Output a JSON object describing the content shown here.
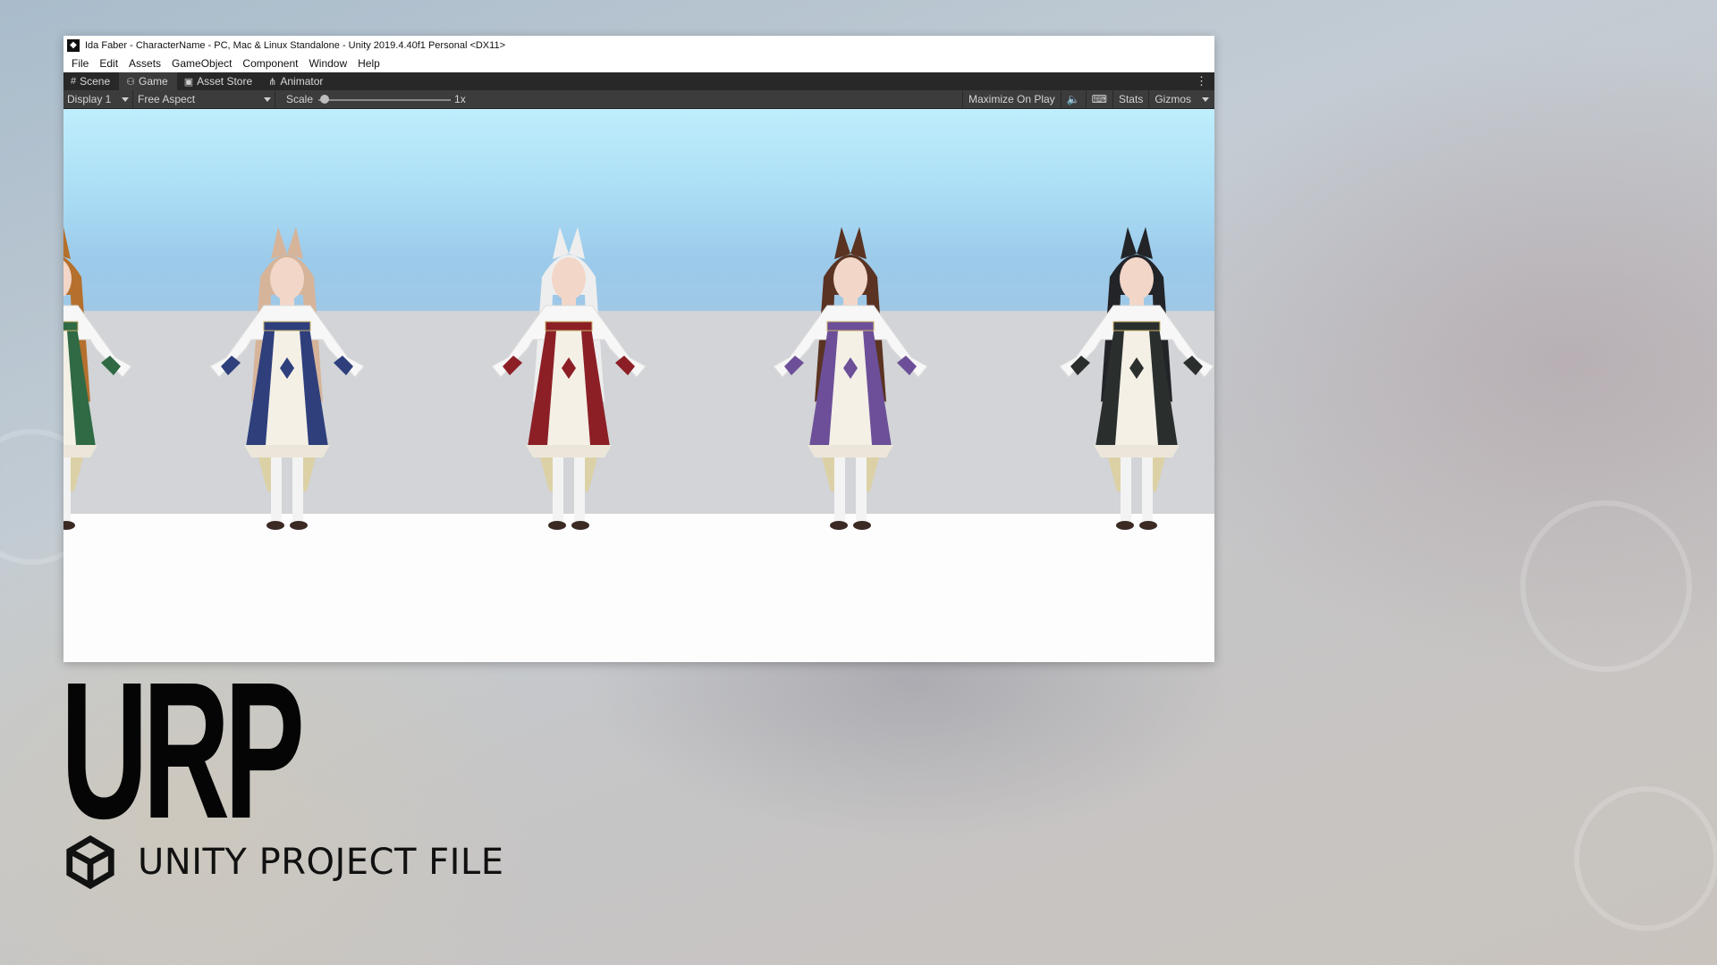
{
  "window": {
    "title": "Ida Faber - CharacterName - PC, Mac & Linux Standalone - Unity 2019.4.40f1 Personal <DX11>",
    "menu": [
      "File",
      "Edit",
      "Assets",
      "GameObject",
      "Component",
      "Window",
      "Help"
    ],
    "tabs": [
      {
        "label": "Scene",
        "icon": "grid-icon"
      },
      {
        "label": "Game",
        "icon": "gamepad-icon"
      },
      {
        "label": "Asset Store",
        "icon": "bag-icon"
      },
      {
        "label": "Animator",
        "icon": "animator-icon"
      }
    ],
    "active_tab": "Game",
    "toolbar": {
      "display": "Display 1",
      "aspect": "Free Aspect",
      "scale_label": "Scale",
      "scale_value": "1x",
      "maximize": "Maximize On Play",
      "stats": "Stats",
      "gizmos": "Gizmos"
    }
  },
  "game_view": {
    "characters": [
      {
        "dress_color": "#2f6a44",
        "hair_color": "#b5702e"
      },
      {
        "dress_color": "#2e3f7c",
        "hair_color": "#d6b49a"
      },
      {
        "dress_color": "#8c1f26",
        "hair_color": "#eeeeee"
      },
      {
        "dress_color": "#6c4f98",
        "hair_color": "#5a3322"
      },
      {
        "dress_color": "#2a2f2e",
        "hair_color": "#222428"
      }
    ]
  },
  "branding": {
    "title": "URP",
    "subtitle": "UNITY PROJECT FILE",
    "logo_icon": "unity-logo-icon"
  }
}
